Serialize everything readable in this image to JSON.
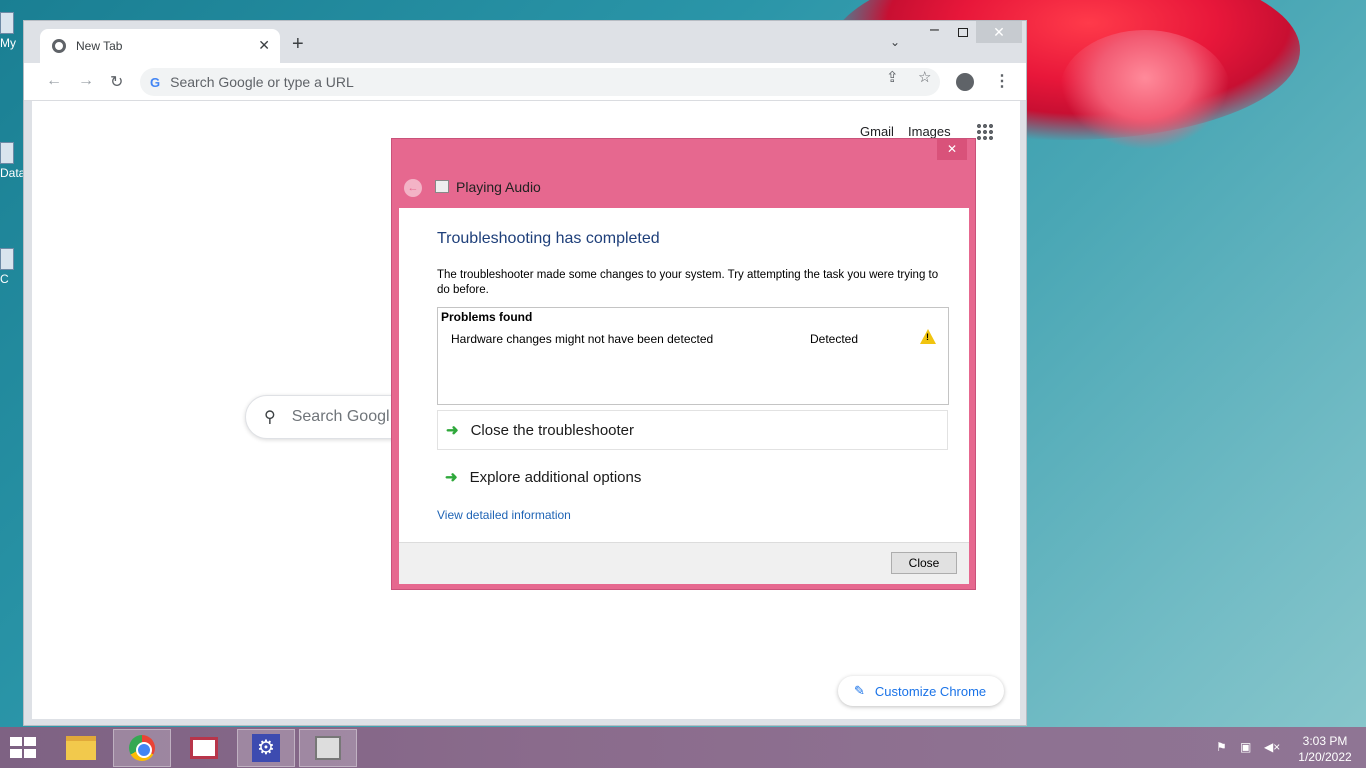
{
  "desktop": {
    "icons": [
      {
        "label": "My"
      },
      {
        "label": "Data"
      },
      {
        "label": "C"
      }
    ]
  },
  "browser": {
    "tab_title": "New Tab",
    "omnibox_placeholder": "Search Google or type a URL",
    "links": {
      "gmail": "Gmail",
      "images": "Images"
    },
    "search_placeholder": "Search Googl",
    "customize_label": "Customize Chrome"
  },
  "dialog": {
    "title": "Playing Audio",
    "heading": "Troubleshooting has completed",
    "description": "The troubleshooter made some changes to your system. Try attempting the task you were trying to do before.",
    "problems_header": "Problems found",
    "problems": [
      {
        "text": "Hardware changes might not have been detected",
        "status": "Detected",
        "icon": "warning-icon"
      }
    ],
    "options": [
      {
        "label": "Close the troubleshooter"
      },
      {
        "label": "Explore additional options"
      }
    ],
    "detail_link": "View detailed information",
    "close_button": "Close"
  },
  "taskbar": {
    "items": [
      "file-explorer",
      "google-chrome",
      "news-app",
      "settings",
      "troubleshooter"
    ],
    "clock": {
      "time": "3:03 PM",
      "date": "1/20/2022"
    }
  },
  "colors": {
    "dialog_frame": "#e6688f",
    "heading_blue": "#1e3f7a",
    "link_blue": "#1f64b5"
  }
}
